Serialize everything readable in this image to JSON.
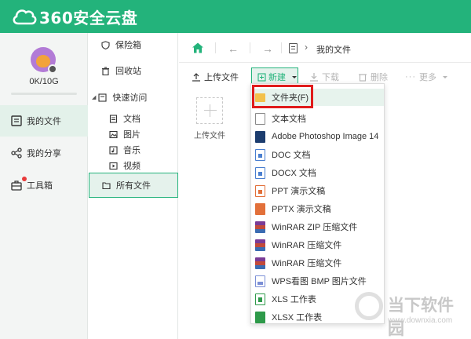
{
  "app": {
    "brand": "360安全云盘",
    "accent_color": "#23b37b"
  },
  "user": {
    "quota_text": "0K/10G",
    "quota_used_fraction": 0.0
  },
  "leftnav": {
    "items": [
      {
        "label": "我的文件",
        "icon": "file-list-icon",
        "active": true
      },
      {
        "label": "我的分享",
        "icon": "share-icon",
        "active": false
      },
      {
        "label": "工具箱",
        "icon": "toolbox-icon",
        "active": false,
        "badge": "red-dot"
      }
    ]
  },
  "secnav": {
    "vault": "保险箱",
    "recycle": "回收站",
    "quick_access": "快速访问",
    "docs": "文档",
    "images": "图片",
    "music": "音乐",
    "video": "视频",
    "all_files": "所有文件"
  },
  "pathbar": {
    "current": "我的文件"
  },
  "toolbar": {
    "upload": "上传文件",
    "new": "新建",
    "download": "下载",
    "delete": "删除",
    "more": "更多"
  },
  "upload_tile": {
    "label": "上传文件"
  },
  "new_menu": {
    "items": [
      {
        "label": "文件夹(F)",
        "icon": "folder-icon"
      },
      {
        "label": "文本文档",
        "icon": "text-doc-icon"
      },
      {
        "label": "Adobe Photoshop Image 14",
        "icon": "photoshop-icon"
      },
      {
        "label": "DOC 文档",
        "icon": "doc-icon"
      },
      {
        "label": "DOCX 文档",
        "icon": "docx-icon"
      },
      {
        "label": "PPT 演示文稿",
        "icon": "ppt-icon"
      },
      {
        "label": "PPTX 演示文稿",
        "icon": "pptx-icon"
      },
      {
        "label": "WinRAR ZIP 压缩文件",
        "icon": "winrar-icon"
      },
      {
        "label": "WinRAR 压缩文件",
        "icon": "winrar-icon"
      },
      {
        "label": "WinRAR 压缩文件",
        "icon": "winrar-icon"
      },
      {
        "label": "WPS看图 BMP 图片文件",
        "icon": "bmp-icon"
      },
      {
        "label": "XLS 工作表",
        "icon": "xls-icon"
      },
      {
        "label": "XLSX 工作表",
        "icon": "xlsx-icon"
      }
    ]
  },
  "watermark": {
    "name": "当下软件园",
    "url": "www.downxia.com"
  }
}
